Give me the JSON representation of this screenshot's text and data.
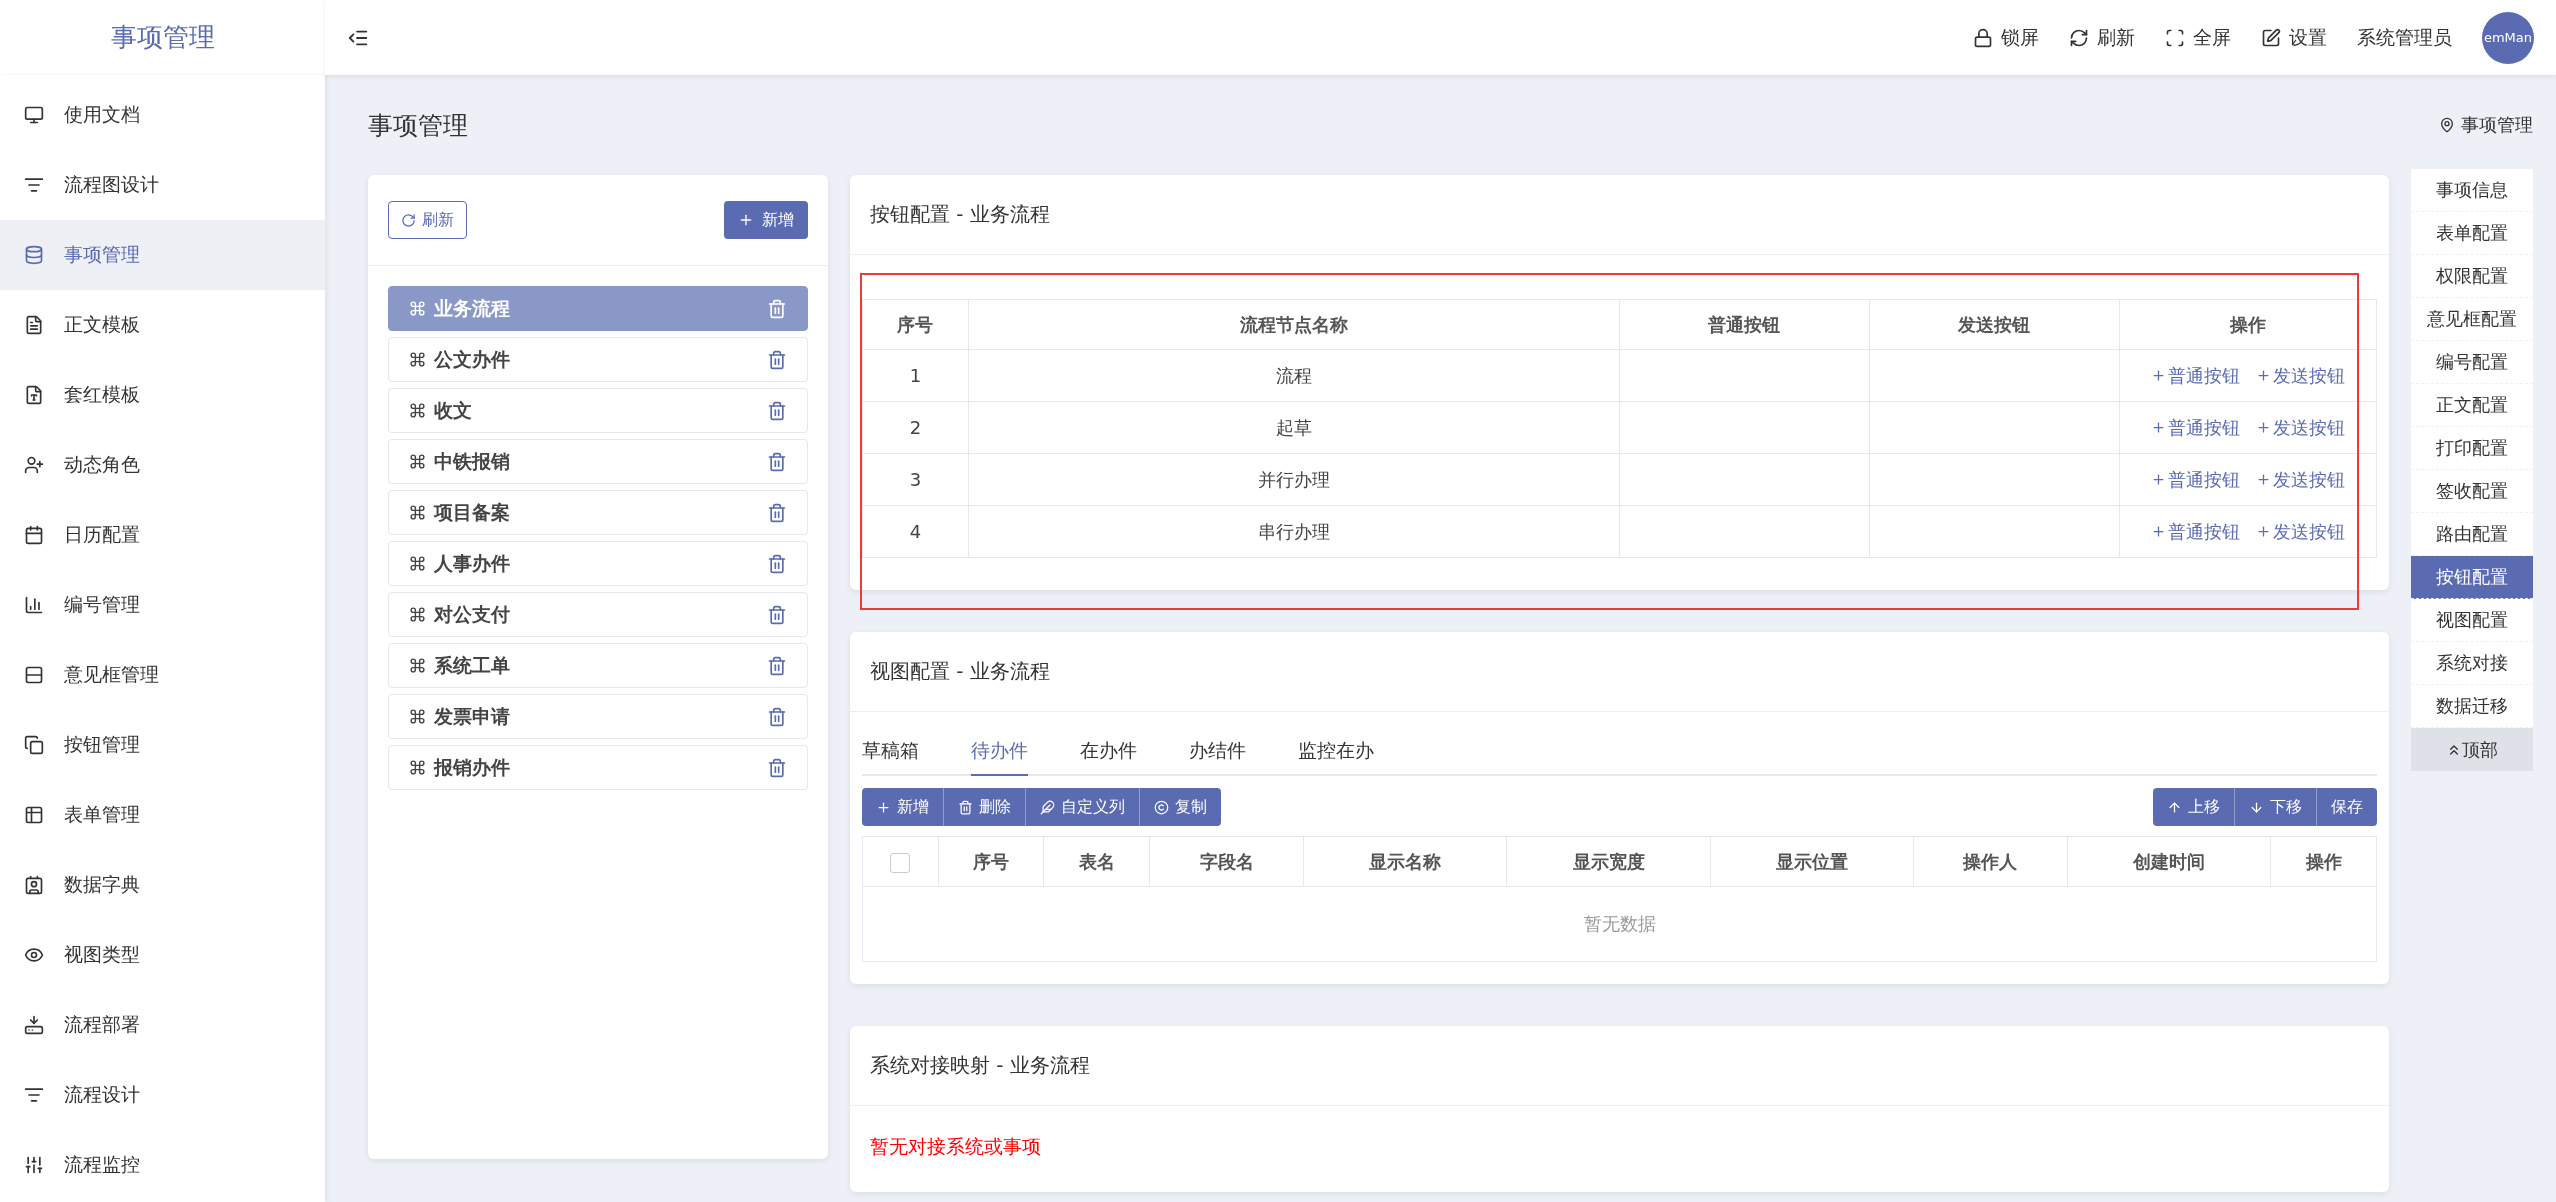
{
  "app": {
    "title": "事项管理"
  },
  "topbar": {
    "actions": [
      {
        "kind": "lock",
        "label": "锁屏"
      },
      {
        "kind": "refresh",
        "label": "刷新"
      },
      {
        "kind": "fullscreen",
        "label": "全屏"
      },
      {
        "kind": "settings",
        "label": "设置"
      }
    ],
    "user": "系统管理员",
    "avatar_text": "emMan"
  },
  "sidebar": {
    "items": [
      {
        "kind": "doc",
        "label": "使用文档",
        "selected": false
      },
      {
        "kind": "flowchart",
        "label": "流程图设计",
        "selected": false
      },
      {
        "kind": "database",
        "label": "事项管理",
        "selected": true
      },
      {
        "kind": "word",
        "label": "正文模板",
        "selected": false
      },
      {
        "kind": "word2",
        "label": "套红模板",
        "selected": false
      },
      {
        "kind": "user",
        "label": "动态角色",
        "selected": false
      },
      {
        "kind": "calendar",
        "label": "日历配置",
        "selected": false
      },
      {
        "kind": "chart",
        "label": "编号管理",
        "selected": false
      },
      {
        "kind": "form",
        "label": "意见框管理",
        "selected": false
      },
      {
        "kind": "copy",
        "label": "按钮管理",
        "selected": false
      },
      {
        "kind": "table",
        "label": "表单管理",
        "selected": false
      },
      {
        "kind": "dict",
        "label": "数据字典",
        "selected": false
      },
      {
        "kind": "eye",
        "label": "视图类型",
        "selected": false
      },
      {
        "kind": "deploy",
        "label": "流程部署",
        "selected": false
      },
      {
        "kind": "flowchart",
        "label": "流程设计",
        "selected": false
      },
      {
        "kind": "sliders",
        "label": "流程监控",
        "selected": false
      }
    ]
  },
  "page": {
    "title": "事项管理",
    "breadcrumb": "事项管理"
  },
  "list_panel": {
    "refresh_label": "刷新",
    "add_label": "新增",
    "items": [
      {
        "label": "业务流程",
        "selected": true
      },
      {
        "label": "公文办件",
        "selected": false
      },
      {
        "label": "收文",
        "selected": false
      },
      {
        "label": "中铁报销",
        "selected": false
      },
      {
        "label": "项目备案",
        "selected": false
      },
      {
        "label": "人事办件",
        "selected": false
      },
      {
        "label": "对公支付",
        "selected": false
      },
      {
        "label": "系统工单",
        "selected": false
      },
      {
        "label": "发票申请",
        "selected": false
      },
      {
        "label": "报销办件",
        "selected": false
      }
    ]
  },
  "button_config": {
    "title": "按钮配置 - 业务流程",
    "highlighted": true,
    "columns": [
      "序号",
      "流程节点名称",
      "普通按钮",
      "发送按钮",
      "操作"
    ],
    "rows": [
      {
        "index": "1",
        "name": "流程",
        "actions": [
          "普通按钮",
          "发送按钮"
        ]
      },
      {
        "index": "2",
        "name": "起草",
        "actions": [
          "普通按钮",
          "发送按钮"
        ]
      },
      {
        "index": "3",
        "name": "并行办理",
        "actions": [
          "普通按钮",
          "发送按钮"
        ]
      },
      {
        "index": "4",
        "name": "串行办理",
        "actions": [
          "普通按钮",
          "发送按钮"
        ]
      }
    ]
  },
  "view_config": {
    "title": "视图配置 - 业务流程",
    "tabs": [
      {
        "label": "草稿箱",
        "selected": false
      },
      {
        "label": "待办件",
        "selected": true
      },
      {
        "label": "在办件",
        "selected": false
      },
      {
        "label": "办结件",
        "selected": false
      },
      {
        "label": "监控在办",
        "selected": false
      }
    ],
    "toolbar_left": [
      {
        "kind": "add",
        "label": "新增"
      },
      {
        "kind": "delete",
        "label": "删除"
      },
      {
        "kind": "custom",
        "label": "自定义列"
      },
      {
        "kind": "copy",
        "label": "复制"
      }
    ],
    "toolbar_right": [
      {
        "kind": "up",
        "label": "上移"
      },
      {
        "kind": "down",
        "label": "下移"
      },
      {
        "kind": "save",
        "label": "保存"
      }
    ],
    "select_all_checked": false,
    "columns": [
      "序号",
      "表名",
      "字段名",
      "显示名称",
      "显示宽度",
      "显示位置",
      "操作人",
      "创建时间",
      "操作"
    ],
    "empty_text": "暂无数据"
  },
  "mapping": {
    "title": "系统对接映射 - 业务流程",
    "message": "暂无对接系统或事项"
  },
  "section_nav": {
    "items": [
      {
        "label": "事项信息",
        "selected": false
      },
      {
        "label": "表单配置",
        "selected": false
      },
      {
        "label": "权限配置",
        "selected": false
      },
      {
        "label": "意见框配置",
        "selected": false
      },
      {
        "label": "编号配置",
        "selected": false
      },
      {
        "label": "正文配置",
        "selected": false
      },
      {
        "label": "打印配置",
        "selected": false
      },
      {
        "label": "签收配置",
        "selected": false
      },
      {
        "label": "路由配置",
        "selected": false
      },
      {
        "label": "按钮配置",
        "selected": true
      },
      {
        "label": "视图配置",
        "selected": false
      },
      {
        "label": "系统对接",
        "selected": false
      },
      {
        "label": "数据迁移",
        "selected": false
      }
    ],
    "top_label": "顶部"
  }
}
